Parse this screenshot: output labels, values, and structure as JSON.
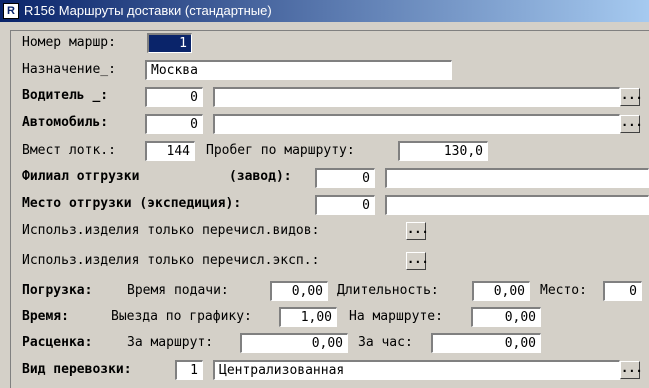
{
  "window": {
    "title": "R156 Маршруты доставки (стандартные)",
    "icon_letter": "R"
  },
  "route_number": {
    "label": "Номер маршр:",
    "value": "1"
  },
  "destination": {
    "label": "Назначение_:",
    "value": "Москва"
  },
  "driver": {
    "label": "Водитель _:",
    "code": "0",
    "name": "",
    "browse": "..."
  },
  "vehicle": {
    "label": "Автомобиль:",
    "code": "0",
    "name": "",
    "browse": "..."
  },
  "capacity": {
    "label": "Вмест лотк.:",
    "value": "144",
    "mileage_label": "Пробег по маршруту:",
    "mileage_value": "130,0"
  },
  "branch": {
    "label": "Филиал отгрузки",
    "sublabel": "(завод):",
    "code": "0",
    "name": ""
  },
  "place": {
    "label": "Место отгрузки (экспедиция):",
    "code": "0",
    "name": ""
  },
  "only_types": {
    "label": "Использ.изделия только перечисл.видов:",
    "browse": "..."
  },
  "only_exp": {
    "label": "Использ.изделия только перечисл.эксп.:",
    "browse": "..."
  },
  "loading": {
    "label": "Погрузка:",
    "time_label": "Время  подачи:",
    "time_value": "0,00",
    "duration_label": "Длительность:",
    "duration_value": "0,00",
    "place_label": "Место:",
    "place_value": "0"
  },
  "time": {
    "label": "Время:",
    "schedule_label": "Выезда по графику:",
    "schedule_value": "1,00",
    "on_route_label": "На маршруте:",
    "on_route_value": "0,00"
  },
  "rate": {
    "label": "Расценка:",
    "per_route_label": "За маршрут:",
    "per_route_value": "0,00",
    "per_hour_label": "За час:",
    "per_hour_value": "0,00"
  },
  "transport": {
    "label": "Вид перевозки:",
    "code": "1",
    "name": "Централизованная",
    "browse": "..."
  }
}
